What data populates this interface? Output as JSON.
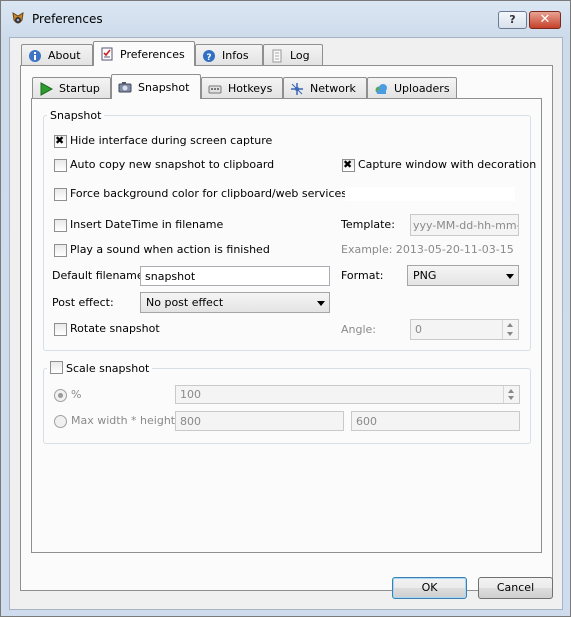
{
  "window": {
    "title": "Preferences",
    "help_button": "?",
    "close_button": "✕"
  },
  "main_tabs": [
    {
      "label": "About",
      "icon": "info-icon"
    },
    {
      "label": "Preferences",
      "icon": "checklist-icon",
      "active": true
    },
    {
      "label": "Infos",
      "icon": "help-circle-icon"
    },
    {
      "label": "Log",
      "icon": "document-icon"
    }
  ],
  "sub_tabs": [
    {
      "label": "Startup",
      "icon": "play-icon"
    },
    {
      "label": "Snapshot",
      "icon": "camera-icon",
      "active": true
    },
    {
      "label": "Hotkeys",
      "icon": "keyboard-icon"
    },
    {
      "label": "Network",
      "icon": "network-icon"
    },
    {
      "label": "Uploaders",
      "icon": "cloud-icon"
    }
  ],
  "snapshot": {
    "group_title": "Snapshot",
    "hide_interface": {
      "label": "Hide interface during screen capture",
      "checked": true
    },
    "auto_copy": {
      "label": "Auto copy new snapshot to clipboard",
      "checked": false
    },
    "capture_decoration": {
      "label": "Capture window with decoration",
      "checked": true
    },
    "force_background": {
      "label": "Force background color for clipboard/web services",
      "checked": false
    },
    "insert_datetime": {
      "label": "Insert DateTime in filename",
      "checked": false
    },
    "template_label": "Template:",
    "template_value": "yyy-MM-dd-hh-mm-ss",
    "play_sound": {
      "label": "Play a sound when action is finished",
      "checked": false
    },
    "example_text": "Example: 2013-05-20-11-03-15",
    "default_filename_label": "Default filename:",
    "default_filename_value": "snapshot",
    "format_label": "Format:",
    "format_value": "PNG",
    "post_effect_label": "Post effect:",
    "post_effect_value": "No post effect",
    "rotate": {
      "label": "Rotate snapshot",
      "checked": false
    },
    "angle_label": "Angle:",
    "angle_value": "0"
  },
  "scale": {
    "group_title": "Scale snapshot",
    "checked": false,
    "percent_label": "%",
    "percent_value": "100",
    "maxwh_label": "Max width * height",
    "width_value": "800",
    "height_value": "600"
  },
  "footer": {
    "ok_label": "OK",
    "cancel_label": "Cancel"
  }
}
